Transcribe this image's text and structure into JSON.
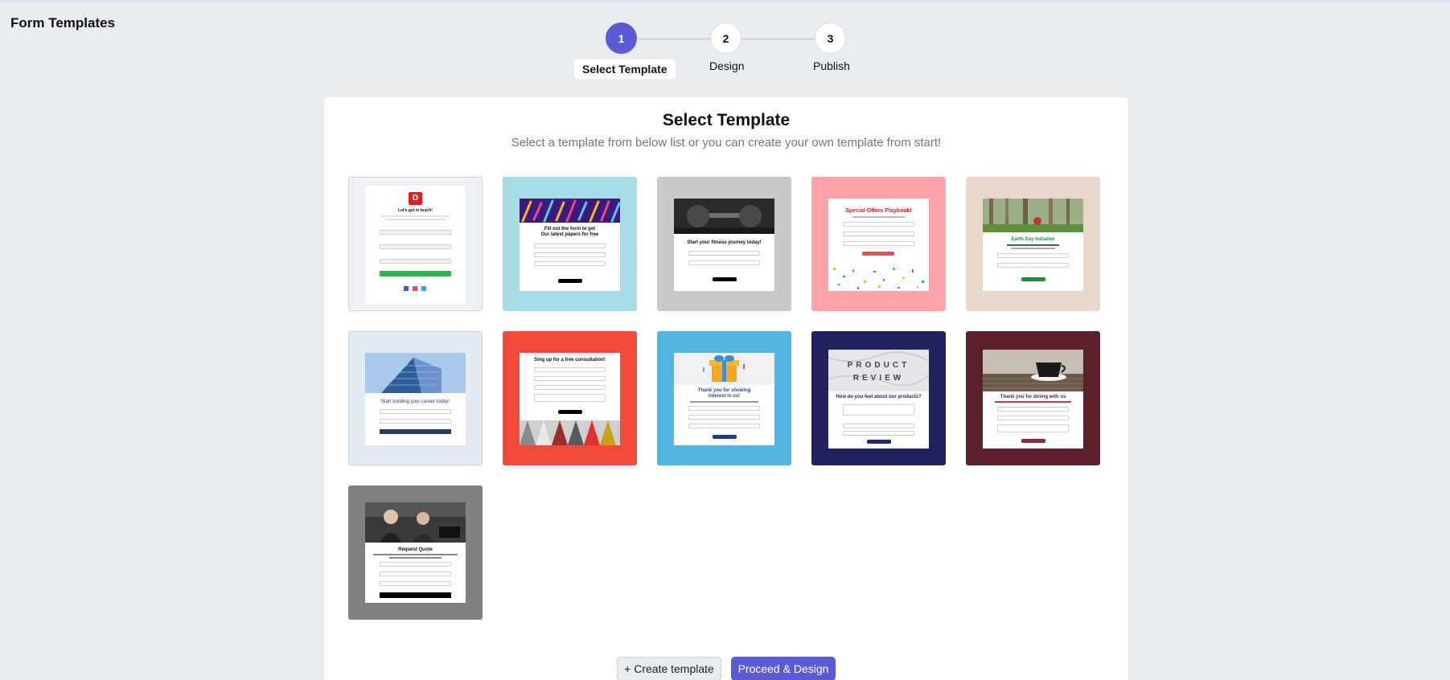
{
  "page": {
    "title": "Form Templates"
  },
  "stepper": {
    "steps": [
      {
        "number": "1",
        "label": "Select Template",
        "active": true
      },
      {
        "number": "2",
        "label": "Design",
        "active": false
      },
      {
        "number": "3",
        "label": "Publish",
        "active": false
      }
    ]
  },
  "card": {
    "title": "Select Template",
    "subtitle": "Select a template from below list or you can create your own template from start!"
  },
  "templates": [
    {
      "heading": "Let's get in touch!",
      "logo": "D",
      "bg": "#eef1f6"
    },
    {
      "heading": "Fill out the form to get",
      "heading2": "Our latest papers for free",
      "bg": "#a6dce6"
    },
    {
      "heading": "Start your fitness journey today!",
      "bg": "#c9c9c9"
    },
    {
      "heading": "Special Offers Playbook!",
      "bg": "#ffa3a8"
    },
    {
      "heading": "Earth Day Initiative",
      "bg": "#e9d7cb"
    },
    {
      "heading": "Start building your career today!",
      "bg": "#e3eaf4"
    },
    {
      "heading": "Sing up for a free consultation!",
      "bg": "#f44a3e"
    },
    {
      "heading": "Thank you for showing",
      "heading2": "interest in us!",
      "bg": "#52b6e2"
    },
    {
      "heading": "How do you feel about our products?",
      "banner": "PRODUCT REVIEW",
      "bg": "#21235e"
    },
    {
      "heading": "Thank you for dining with us",
      "bg": "#5c1f2c"
    },
    {
      "heading": "Request Quote",
      "bg": "#818181"
    }
  ],
  "actions": {
    "create_label": "+ Create template",
    "proceed_label": "Proceed & Design"
  },
  "colors": {
    "accent": "#5b5bd6",
    "background": "#e9ecf1"
  }
}
